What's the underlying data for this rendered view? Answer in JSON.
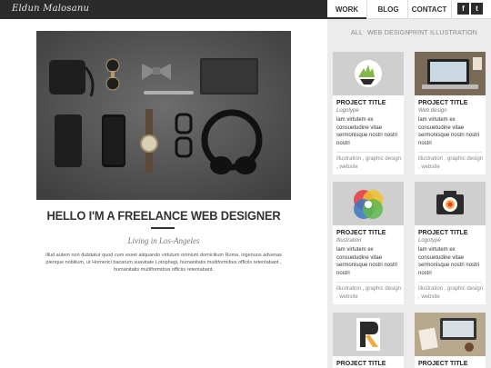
{
  "brand": {
    "name": "Eldun Malosanu"
  },
  "nav": {
    "items": [
      "WORK",
      "BLOG",
      "CONTACT"
    ],
    "active": "WORK",
    "social": [
      "f",
      "t"
    ]
  },
  "filters": [
    "ALL",
    "WEB DESIGN",
    "PRINT",
    "ILLUSTRATION"
  ],
  "hero": {
    "headline": "HELLO I'M A FREELANCE WEB DESIGNER",
    "subheading": "Living in Los-Angeles",
    "intro": "Illud autem non dubitatur quod cum esset aliquando virtutum omnium domicilium Roma, ingenuos advenas plerique nobilium, ut Homerici bacarum suavitate Lotophagi, humanitatis multiformibus officiis retentabant , humanitatis multiformibus officiis retentabant."
  },
  "projects": [
    {
      "title": "PROJECT TITLE",
      "category": "Logotype",
      "description": "lam virtutem ex consuetudine vitae sermonisque nostri nostri nostri",
      "tags": "illustration , graphic design , website",
      "icon": "hand-logo"
    },
    {
      "title": "PROJECT TITLE",
      "category": "Web design",
      "description": "lam virtutem ex consuetudine vitae sermonisque nostri nostri nostri",
      "tags": "illustration , graphic design , website",
      "icon": "laptop-photo"
    },
    {
      "title": "PROJECT TITLE",
      "category": "Illustration",
      "description": "lam virtutem ex consuetudine vitae sermonisque nostri nostri nostri",
      "tags": "illustration , graphic design , website",
      "icon": "color-circles"
    },
    {
      "title": "PROJECT TITLE",
      "category": "Logotype",
      "description": "lam virtutem ex consuetudine vitae sermonisque nostri nostri nostri",
      "tags": "illustration , graphic design , website",
      "icon": "camera-logo"
    },
    {
      "title": "PROJECT TITLE",
      "category": "",
      "description": "",
      "tags": "",
      "icon": "letter-r-logo"
    },
    {
      "title": "PROJECT TITLE",
      "category": "",
      "description": "",
      "tags": "",
      "icon": "desk-photo"
    }
  ],
  "colors": {
    "dark": "#2b2b2b",
    "panel": "#ececec",
    "accent": "#84b84a"
  }
}
